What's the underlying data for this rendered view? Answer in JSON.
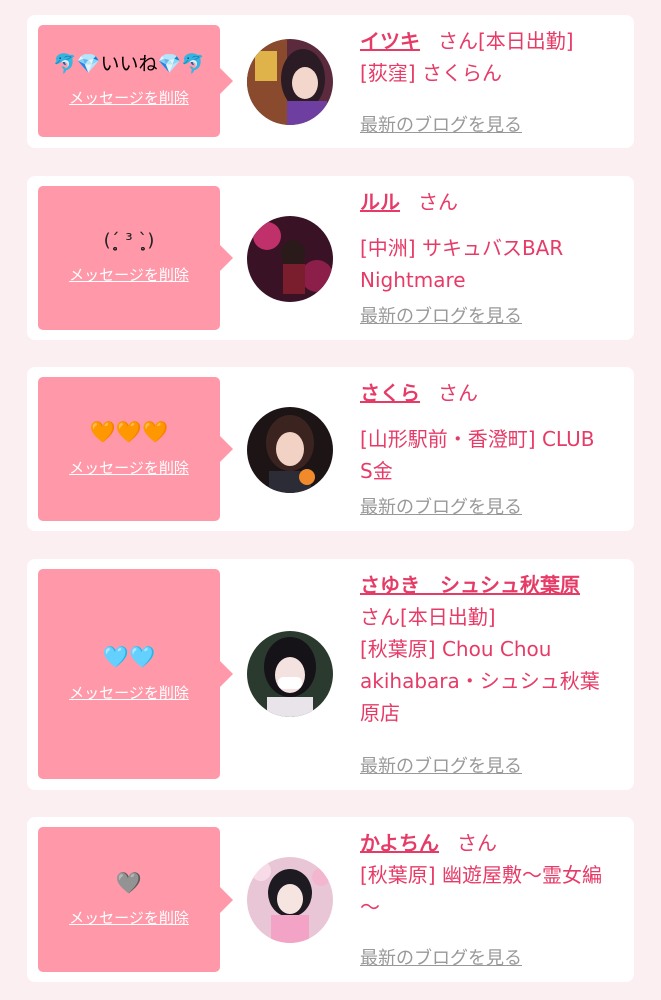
{
  "cards": [
    {
      "message": "🐬💎いいね💎🐬",
      "delete_label": "メッセージを削除",
      "name": "イツキ",
      "honorific": "さん",
      "status": "[本日出勤]",
      "shop_line1": "[荻窪] さくらん",
      "shop_line2": "",
      "blog_label": "最新のブログを見る"
    },
    {
      "message": "(ˊ̥̥̥̥̥ ³ ˋ̥̥̥̥̥)",
      "delete_label": "メッセージを削除",
      "name": "ルル",
      "honorific": "さん",
      "status": "",
      "shop_line1": "[中洲] サキュバスBAR",
      "shop_line2": "Nightmare",
      "blog_label": "最新のブログを見る"
    },
    {
      "message": "🧡🧡🧡",
      "delete_label": "メッセージを削除",
      "name": "さくら",
      "honorific": "さん",
      "status": "",
      "shop_line1": "[山形駅前・香澄町] CLUB",
      "shop_line2": "S金",
      "blog_label": "最新のブログを見る"
    },
    {
      "message": "🩵🩵",
      "delete_label": "メッセージを削除",
      "name": "さゆき　シュシュ秋葉原",
      "honorific": "さん",
      "status": "[本日出勤]",
      "shop_line1": "[秋葉原] Chou Chou",
      "shop_line2": "akihabara・シュシュ秋葉",
      "shop_line3": "原店",
      "blog_label": "最新のブログを見る"
    },
    {
      "message": "🩶",
      "delete_label": "メッセージを削除",
      "name": "かよちん",
      "honorific": "さん",
      "status": "",
      "shop_line1": "[秋葉原] 幽遊屋敷〜霊女編",
      "shop_line2": "〜",
      "blog_label": "最新のブログを見る"
    }
  ],
  "colors": {
    "page_bg": "#fbeff2",
    "bubble": "#ff98a8",
    "accent": "#e63b67",
    "muted": "#999999"
  }
}
